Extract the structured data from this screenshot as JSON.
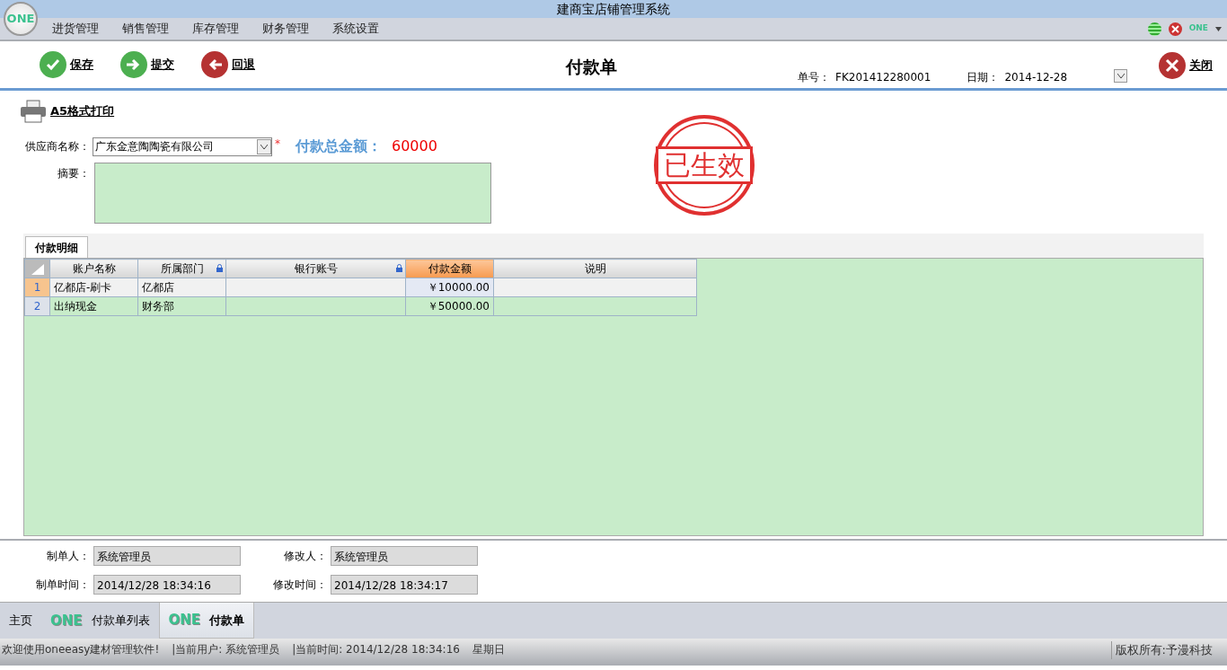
{
  "window": {
    "title": "建商宝店铺管理系统",
    "logo": "ONE",
    "corner_logo": "ONE"
  },
  "menu": [
    "进货管理",
    "销售管理",
    "库存管理",
    "财务管理",
    "系统设置"
  ],
  "toolbar": {
    "buttons": [
      {
        "label": "保存",
        "kind": "save"
      },
      {
        "label": "提交",
        "kind": "submit"
      },
      {
        "label": "回退",
        "kind": "back"
      }
    ],
    "title": "付款单",
    "number_label": "单号：",
    "number": "FK201412280001",
    "date_label": "日期：",
    "date": "2014-12-28",
    "close": "关闭"
  },
  "print": "A5格式打印",
  "form": {
    "supplier_label": "供应商名称：",
    "supplier": "广东金意陶陶瓷有限公司",
    "required_mark": "*",
    "total_label": "付款总金额：",
    "total": "60000",
    "memo_label": "摘要："
  },
  "stamp": "已生效",
  "detail_tabs": [
    {
      "label": "付款明细",
      "selected": true
    }
  ],
  "table": {
    "columns": [
      {
        "label": "账户名称",
        "locked": false,
        "selected": false
      },
      {
        "label": "所属部门",
        "locked": true,
        "selected": false
      },
      {
        "label": "银行账号",
        "locked": true,
        "selected": false
      },
      {
        "label": "付款金额",
        "locked": false,
        "selected": true
      },
      {
        "label": "说明",
        "locked": false,
        "selected": false
      }
    ],
    "rows": [
      {
        "index": "1",
        "selected": true,
        "cells": [
          "亿都店-刷卡",
          "亿都店",
          "",
          "￥10000.00",
          ""
        ]
      },
      {
        "index": "2",
        "selected": false,
        "cells": [
          "出纳现金",
          "财务部",
          "",
          "￥50000.00",
          ""
        ]
      }
    ]
  },
  "footer": [
    {
      "label": "制单人：",
      "value": "系统管理员"
    },
    {
      "label": "修改人：",
      "value": "系统管理员"
    },
    {
      "label": "制单时间：",
      "value": "2014/12/28 18:34:16"
    },
    {
      "label": "修改时间：",
      "value": "2014/12/28 18:34:17"
    }
  ],
  "tabs": [
    {
      "label": "主页",
      "selected": false
    },
    {
      "label": "付款单列表",
      "logo": "ONE",
      "selected": false
    },
    {
      "label": "付款单",
      "logo": "ONE",
      "selected": true
    }
  ],
  "status_bar": {
    "segments": [
      "欢迎使用oneeasy建材管理软件!",
      "|当前用户: 系统管理员",
      "|当前时间: 2014/12/28 18:34:16",
      "星期日"
    ],
    "copyright": "版权所有:予漫科技"
  }
}
